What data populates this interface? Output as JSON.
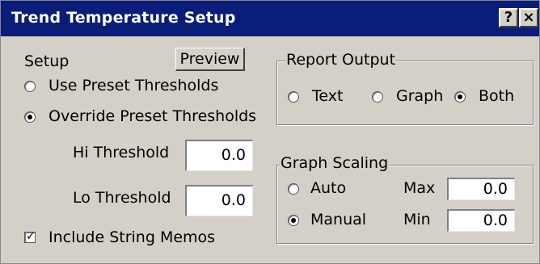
{
  "window": {
    "title": "Trend Temperature  Setup",
    "help_label": "?",
    "close_label": "×"
  },
  "setup": {
    "label": "Setup",
    "preview_label": "Preview",
    "use_preset_label": "Use Preset Thresholds",
    "override_label": "Override Preset Thresholds",
    "hi_label": "Hi Threshold",
    "hi_value": "0.0",
    "lo_label": "Lo Threshold",
    "lo_value": "0.0",
    "memos_label": "Include String Memos"
  },
  "report_output": {
    "title": "Report Output",
    "text_label": "Text",
    "graph_label": "Graph",
    "both_label": "Both",
    "selected": "Both"
  },
  "graph_scaling": {
    "title": "Graph Scaling",
    "auto_label": "Auto",
    "manual_label": "Manual",
    "max_label": "Max",
    "max_value": "0.0",
    "min_label": "Min",
    "min_value": "0.0",
    "selected": "Manual"
  },
  "colors": {
    "titlebar": "#0a1e79",
    "face": "#d4d0c8"
  }
}
